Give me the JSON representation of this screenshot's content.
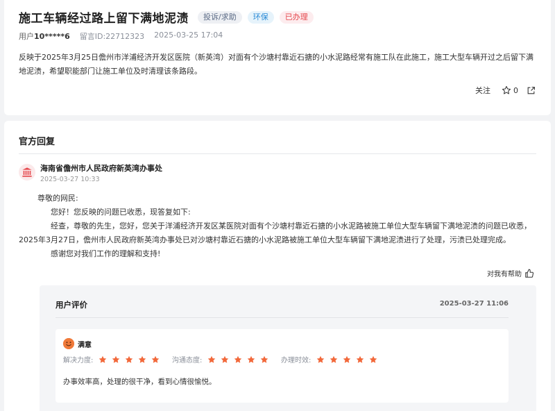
{
  "post": {
    "title": "施工车辆经过路上留下满地泥渍",
    "tags": [
      {
        "label": "投诉/求助",
        "color": "#5a6a85"
      },
      {
        "label": "环保",
        "color": "#2a8ad6"
      },
      {
        "label": "已办理",
        "color": "#e5484d"
      }
    ],
    "user_prefix": "用户",
    "user_id": "10*****6",
    "message_id": "留言ID:22712323",
    "time": "2025-03-25 17:04",
    "body": "反映于2025年3月25日儋州市洋浦经济开发区医院（新英湾）对面有个沙塘村靠近石搪的小水泥路经常有施工队在此施工，施工大型车辆开过之后留下满地泥渍，希望职能部门让施工单位及时清理该条路段。",
    "follow_label": "关注",
    "star_count": "0",
    "star_icon": "star-outline-icon",
    "share_icon": "share-icon"
  },
  "reply": {
    "section_title": "官方回复",
    "org_icon": "government-building-icon",
    "org_name": "海南省儋州市人民政府新英湾办事处",
    "org_time": "2025-03-27 10:33",
    "paragraphs": [
      "尊敬的网民:",
      "您好！您反映的问题已收悉，现答复如下:",
      "经查，尊敬的先生，您好，您关于洋浦经济开发区某医院对面有个沙塘村靠近石搪的小水泥路被施工单位大型车辆留下满地泥渍的问题已收悉，2025年3月27日，儋州市人民政府新英湾办事处已对沙塘村靠近石搪的小水泥路被施工单位大型车辆留下满地泥渍进行了处理，污渍已处理完成。",
      "感谢您对我们工作的理解和支持!"
    ],
    "helpful_label": "对我有帮助",
    "helpful_icon": "thumbs-up-icon"
  },
  "evaluation": {
    "title": "用户评价",
    "time": "2025-03-27 11:06",
    "satisfaction": "满意",
    "satisfaction_icon": "smiley-face-icon",
    "ratings": [
      {
        "label": "解决力度:",
        "stars": 5
      },
      {
        "label": "沟通态度:",
        "stars": 5
      },
      {
        "label": "办理时效:",
        "stars": 5
      }
    ],
    "star_color": "#f2683a",
    "comment": "办事效率高，处理的很干净，看到心情很愉悦。"
  }
}
